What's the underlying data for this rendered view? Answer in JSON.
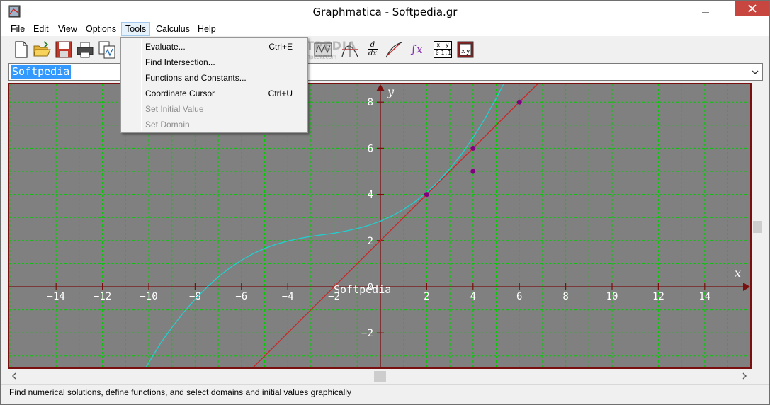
{
  "window": {
    "title": "Graphmatica - Softpedia.gr",
    "icons": {
      "app": "graphmatica-app-icon",
      "minimize": "minimize-icon",
      "close": "close-icon"
    }
  },
  "menubar": {
    "items": [
      "File",
      "Edit",
      "View",
      "Options",
      "Tools",
      "Calculus",
      "Help"
    ],
    "open_menu": "Tools"
  },
  "toolbar": {
    "buttons": [
      "new-file-icon",
      "open-folder-icon",
      "save-icon",
      "print-icon",
      "copy-graph-icon",
      "tangent-icon",
      "derivative-icon",
      "secant-icon",
      "integral-icon",
      "table-icon",
      "data-plot-icon",
      "graph-type-icon"
    ],
    "derivative_text": {
      "top": "d",
      "bottom": "dx"
    },
    "integral_text": "∫x",
    "table_text": {
      "h1": "x",
      "h2": "y",
      "v1": "0",
      "v2": "1.1"
    }
  },
  "input": {
    "value": "Softpedia"
  },
  "tools_menu": {
    "items": [
      {
        "label": "Evaluate...",
        "shortcut": "Ctrl+E",
        "enabled": true
      },
      {
        "label": "Find Intersection...",
        "shortcut": "",
        "enabled": true
      },
      {
        "label": "Functions and Constants...",
        "shortcut": "",
        "enabled": true
      },
      {
        "label": "Coordinate Cursor",
        "shortcut": "Ctrl+U",
        "enabled": true
      },
      {
        "label": "Set Initial Value",
        "shortcut": "",
        "enabled": false
      },
      {
        "label": "Set Domain",
        "shortcut": "",
        "enabled": false
      }
    ]
  },
  "watermark": {
    "text": "SOFTPEDIA",
    "url": "www.softpedia.com"
  },
  "status": {
    "text": "Find numerical solutions, define functions, and select domains and initial values graphically"
  },
  "chart_data": {
    "type": "line",
    "xlabel": "x",
    "ylabel": "y",
    "xlim": [
      -16,
      16
    ],
    "ylim": [
      -3.6,
      8.8
    ],
    "grid": true,
    "grid_color": "#00cc00",
    "background": "#808080",
    "axis_color": "#7a0f0f",
    "x_ticks": [
      -14,
      -12,
      -10,
      -8,
      -6,
      -4,
      -2,
      0,
      2,
      4,
      6,
      8,
      10,
      12,
      14
    ],
    "x_tick_labels": [
      "−14",
      "−12",
      "−10",
      "−8",
      "−6",
      "−4",
      "−2",
      "0",
      "2",
      "4",
      "6",
      "8",
      "10",
      "12",
      "14"
    ],
    "y_ticks": [
      -2,
      0,
      2,
      4,
      6,
      8
    ],
    "y_tick_labels": [
      "−2",
      "0",
      "2",
      "4",
      "6",
      "8"
    ],
    "graph_label": "Softpedia",
    "series": [
      {
        "color": "#20d0d0",
        "x": [
          -10.2,
          -9.5,
          -9,
          -8.5,
          -8,
          -7.5,
          -7,
          -6.5,
          -6,
          -5.5,
          -5,
          -4.5,
          -4,
          -3.5,
          -3,
          -2.5,
          -2,
          -1.5,
          -1,
          -0.5,
          0,
          0.5,
          1,
          1.5,
          2,
          2.5,
          3,
          3.5,
          4,
          4.5,
          5,
          5.5,
          6,
          6.5
        ],
        "y": [
          -3.62,
          -2.46,
          -1.76,
          -1.12,
          -0.54,
          -0.03,
          0.43,
          0.82,
          1.15,
          1.43,
          1.66,
          1.84,
          1.98,
          2.09,
          2.18,
          2.25,
          2.32,
          2.41,
          2.52,
          2.66,
          2.84,
          3.07,
          3.35,
          3.69,
          4.09,
          4.56,
          5.11,
          5.74,
          6.46,
          7.26,
          8.16,
          9.14,
          10.2,
          11.4
        ]
      },
      {
        "color": "#c82828",
        "x": [
          -5.5,
          7
        ],
        "y": [
          -3.5,
          9.0
        ]
      }
    ],
    "points": [
      {
        "x": 2,
        "y": 4
      },
      {
        "x": 4,
        "y": 6
      },
      {
        "x": 4,
        "y": 5
      },
      {
        "x": 6,
        "y": 8
      }
    ],
    "point_color": "#800080"
  }
}
